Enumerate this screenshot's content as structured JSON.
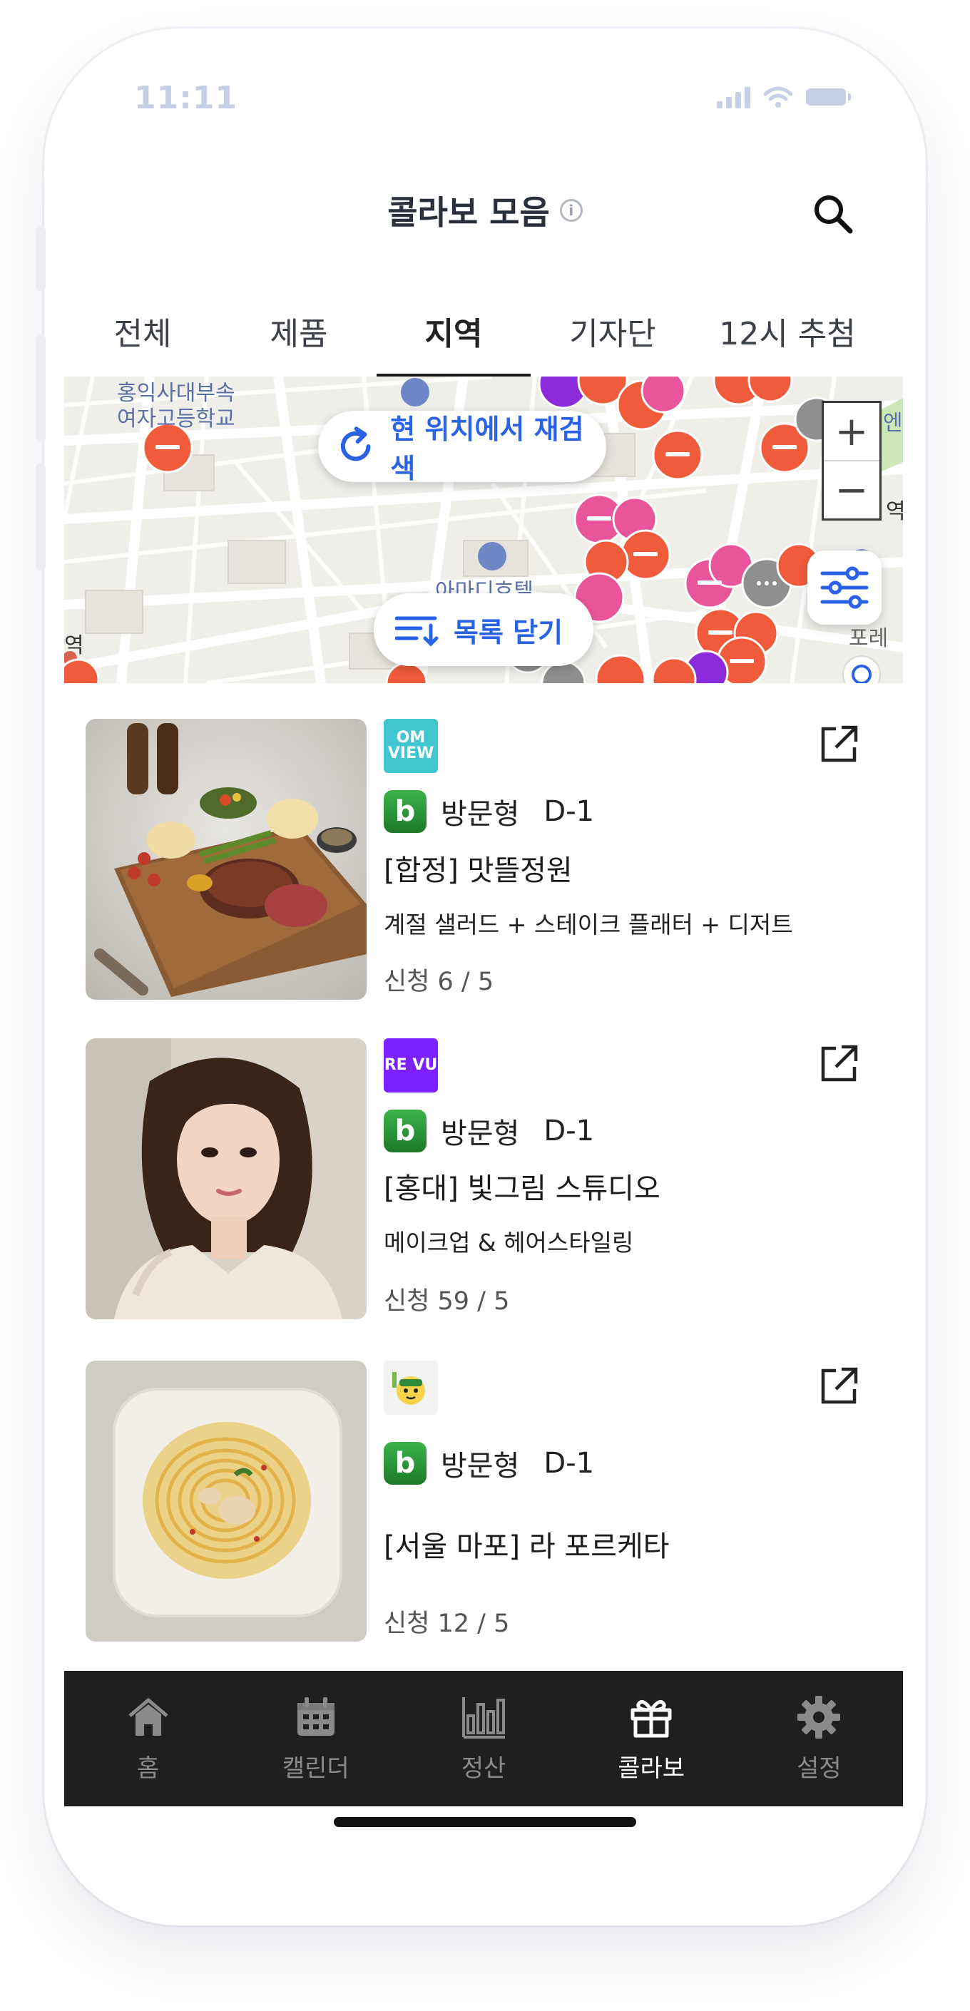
{
  "status_bar": {
    "time": "11:11"
  },
  "header": {
    "title": "콜라보 모음"
  },
  "tabs": [
    {
      "label": "전체",
      "active": false
    },
    {
      "label": "제품",
      "active": false
    },
    {
      "label": "지역",
      "active": true
    },
    {
      "label": "기자단",
      "active": false
    },
    {
      "label": "12시 추첨",
      "active": false
    }
  ],
  "map": {
    "research_label": "현 위치에서 재검색",
    "close_list_label": "목록 닫기",
    "zoom_in": "+",
    "zoom_out": "−",
    "place_labels": [
      "홍익사대부속",
      "여자고등학교",
      "홍",
      "역",
      "엔",
      "아마디호텔",
      "포레",
      "역"
    ]
  },
  "items": [
    {
      "platform": "OHMYVIEW",
      "platform_logo_text": "OM VIEW",
      "platform_color": "#3fc6cf",
      "type_badge": "b",
      "type": "방문형",
      "dday": "D-1",
      "title": "[합정] 맛뜰정원",
      "description": "계절 샐러드 + 스테이크 플래터 + 디저트",
      "apply": "신청 6 / 5",
      "image": "steak-platter"
    },
    {
      "platform": "REVU",
      "platform_logo_text": "RE VU",
      "platform_color": "#7b20ff",
      "type_badge": "b",
      "type": "방문형",
      "dday": "D-1",
      "title": "[홍대] 빛그림 스튜디오",
      "description": "메이크업 & 헤어스타일링",
      "apply": "신청 59 / 5",
      "image": "portrait"
    },
    {
      "platform": "character-logo",
      "platform_logo_text": "",
      "platform_color": "#f3f3f3",
      "type_badge": "b",
      "type": "방문형",
      "dday": "D-1",
      "title": "[서울 마포] 라 포르케타",
      "description": "",
      "apply": "신청 12 / 5",
      "image": "pasta"
    }
  ],
  "bottom_nav": [
    {
      "label": "홈",
      "icon": "home-icon",
      "active": false
    },
    {
      "label": "캘린더",
      "icon": "calendar-icon",
      "active": false
    },
    {
      "label": "정산",
      "icon": "bar-chart-icon",
      "active": false
    },
    {
      "label": "콜라보",
      "icon": "gift-icon",
      "active": true
    },
    {
      "label": "설정",
      "icon": "gear-icon",
      "active": false
    }
  ],
  "colors": {
    "accent_blue": "#2a62e6",
    "nav_bg": "#1f1f1f",
    "marker_orange": "#ef5b3b",
    "marker_pink": "#e9559a"
  }
}
